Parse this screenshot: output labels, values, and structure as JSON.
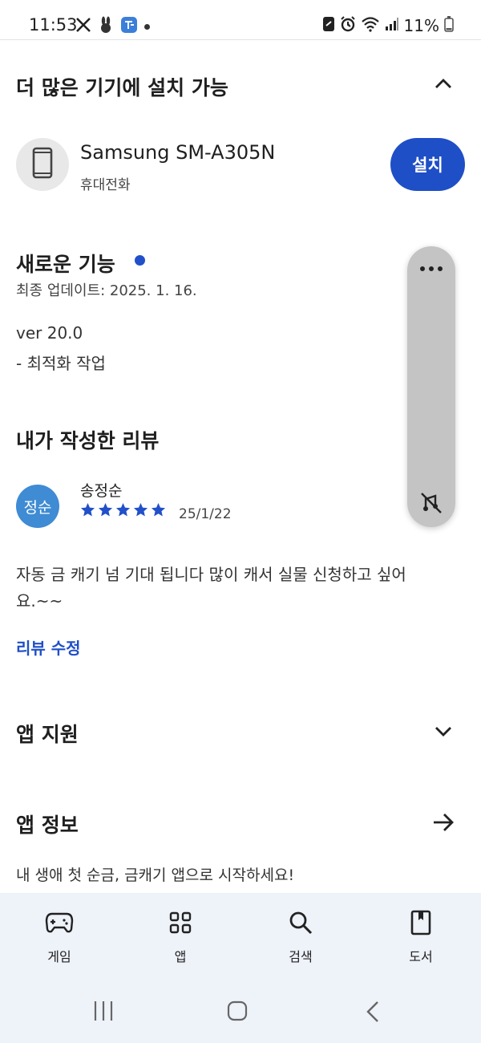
{
  "status_bar": {
    "time": "11:53",
    "battery": "11%",
    "left_icons": [
      "x-icon",
      "rabbit-icon",
      "app-badge-icon",
      "notification-dot"
    ],
    "right_icons": [
      "app-icon",
      "alarm-icon",
      "wifi-icon",
      "signal-icon",
      "battery-icon"
    ]
  },
  "devices": {
    "title": "더 많은 기기에 설치 가능",
    "device_name": "Samsung SM-A305N",
    "device_type": "휴대전화",
    "install_label": "설치"
  },
  "whats_new": {
    "title": "새로운 기능",
    "updated": "최종 업데이트: 2025. 1. 16.",
    "version": "ver 20.0",
    "note": "- 최적화 작업"
  },
  "my_review": {
    "title": "내가 작성한 리뷰",
    "avatar_text": "정순",
    "reviewer": "송정순",
    "rating": 5,
    "date": "25/1/22",
    "text": "자동 금 캐기 넘 기대 됩니다 많이 캐서 실물 신청하고 싶어요.~~",
    "edit_label": "리뷰 수정"
  },
  "app_support": {
    "title": "앱 지원"
  },
  "app_info": {
    "title": "앱 정보",
    "description": "내 생애 첫 순금, 금캐기 앱으로 시작하세요!"
  },
  "bottom_nav": {
    "items": [
      {
        "label": "게임",
        "icon": "gamepad-icon"
      },
      {
        "label": "앱",
        "icon": "apps-grid-icon"
      },
      {
        "label": "검색",
        "icon": "search-icon"
      },
      {
        "label": "도서",
        "icon": "book-icon"
      }
    ]
  },
  "colors": {
    "accent": "#1f4fc7",
    "avatar": "#3f8bd4",
    "nav_bg": "#eef2f9"
  }
}
